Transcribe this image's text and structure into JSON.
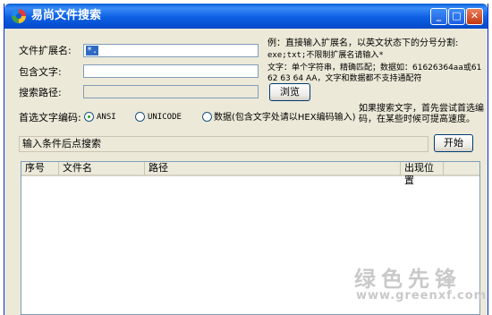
{
  "window": {
    "title": "易尚文件搜索",
    "min_glyph": "_",
    "max_glyph": "□",
    "close_glyph": "✕"
  },
  "form": {
    "ext_label": "文件扩展名:",
    "ext_value": "*.",
    "contains_label": "包含文字:",
    "contains_value": "",
    "path_label": "搜索路径:",
    "path_value": "",
    "browse_button": "浏览"
  },
  "hints": {
    "ext_hint_line1": "例：直接输入扩展名，以英文状态下的分号分割:",
    "ext_hint_line2": "exe;txt;不限制扩展名请输入*",
    "contains_hint_line1": "文字：单个字符串，精确匹配；数据如：61626364aa或61",
    "contains_hint_line2": "62 63 64 AA，文字和数据都不支持通配符",
    "encoding_hint_line1": "如果搜索文字，首先尝试首选编",
    "encoding_hint_line2": "码，在某些时候可提高速度。"
  },
  "encoding": {
    "label": "首选文字编码:",
    "options": [
      {
        "label": "ANSI",
        "checked": true
      },
      {
        "label": "UNICODE",
        "checked": false
      },
      {
        "label": "数据(包含文字处请以HEX编码输入)",
        "checked": false
      }
    ]
  },
  "status": {
    "text": "输入条件后点搜索",
    "start_button": "开始"
  },
  "results": {
    "columns": [
      "序号",
      "文件名",
      "路径",
      "出现位置"
    ],
    "rows": []
  },
  "watermark": {
    "text": "绿色先锋",
    "url": "www.greenxf.com"
  }
}
